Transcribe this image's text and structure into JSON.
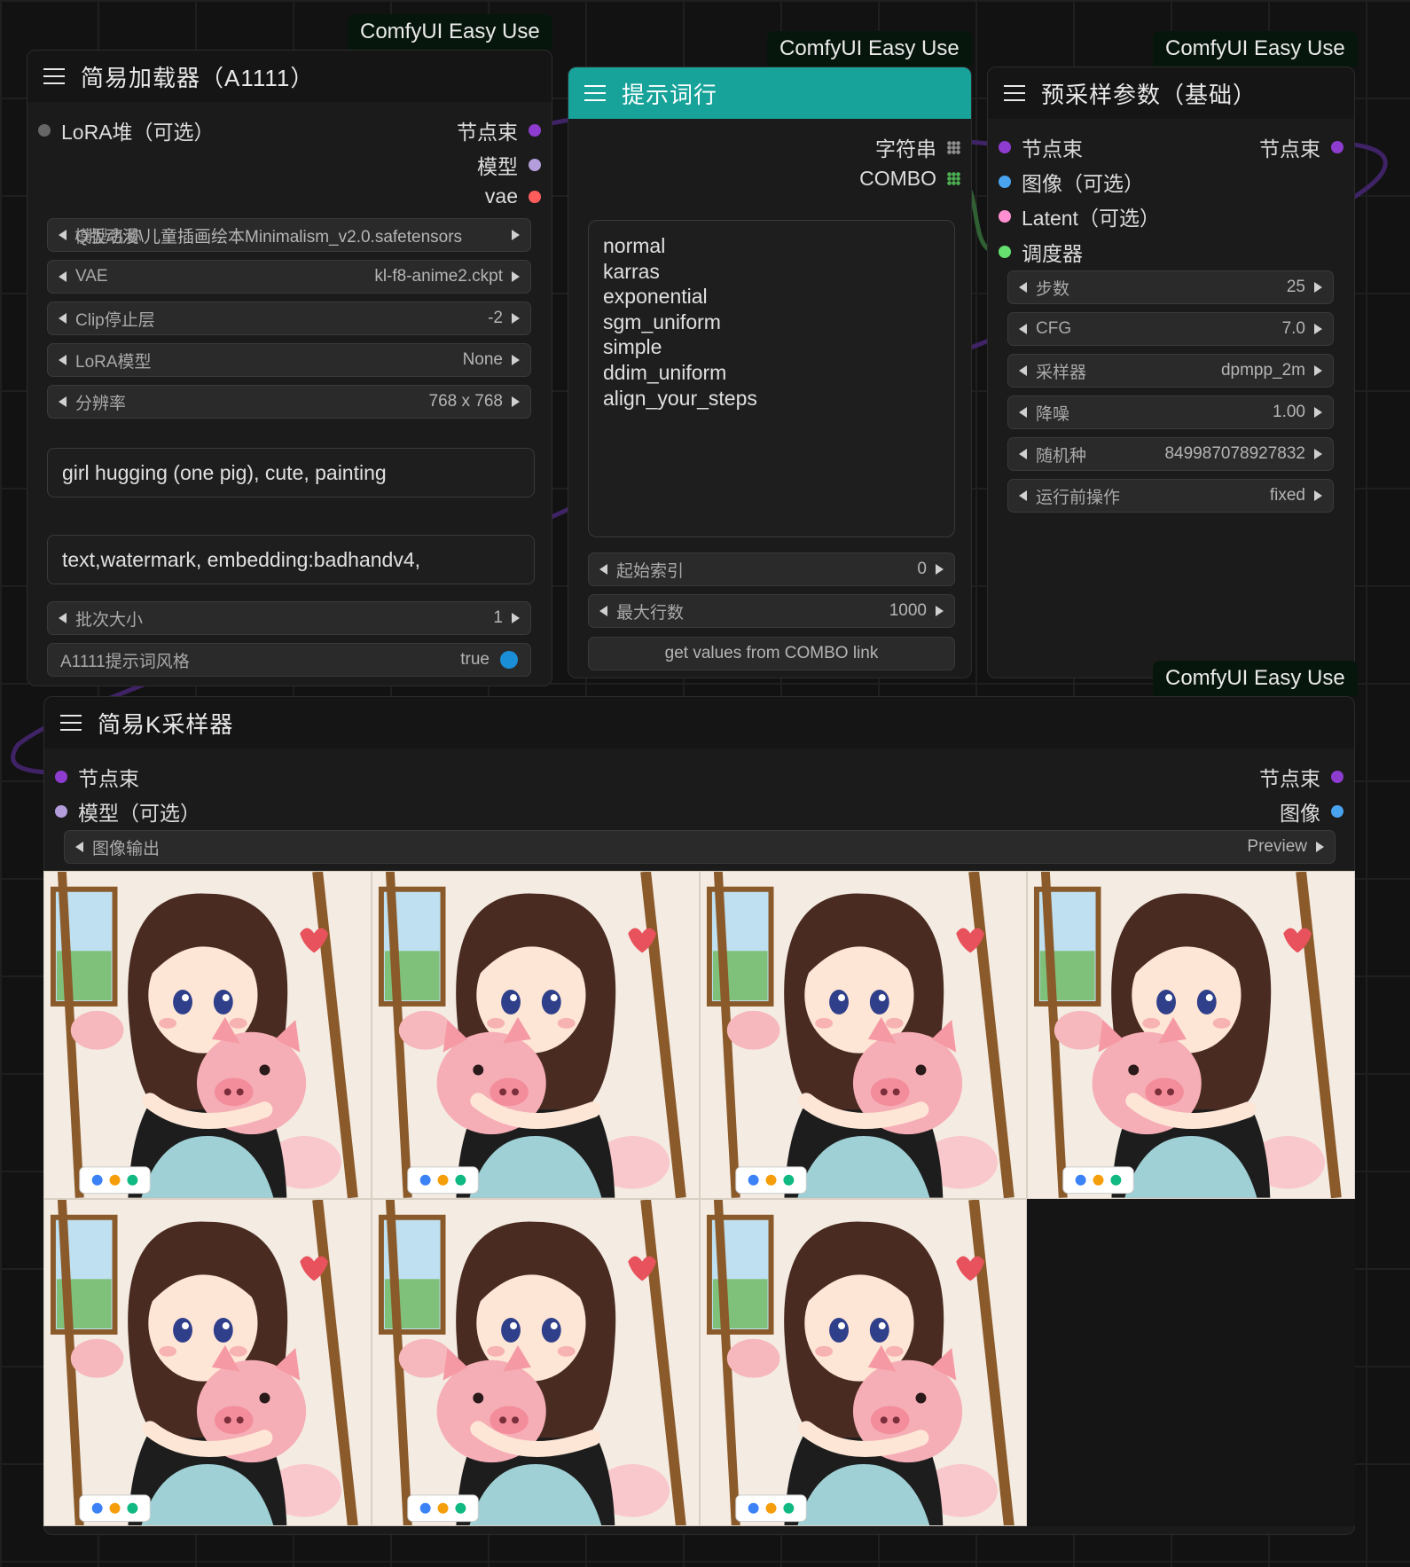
{
  "badge_text": "ComfyUI Easy Use",
  "loader": {
    "title": "简易加载器（A1111）",
    "input_lora_stack": "LoRA堆（可选）",
    "outputs": [
      "节点束",
      "模型",
      "vae"
    ],
    "widgets": [
      {
        "label": "模型名称",
        "value": "Q版动漫\\儿童插画绘本Minimalism_v2.0.safetensors"
      },
      {
        "label": "VAE",
        "value": "kl-f8-anime2.ckpt"
      },
      {
        "label": "Clip停止层",
        "value": "-2"
      },
      {
        "label": "LoRA模型",
        "value": "None"
      },
      {
        "label": "分辨率",
        "value": "768 x 768"
      }
    ],
    "positive": "girl hugging (one pig), cute, painting",
    "negative": "text,watermark, embedding:badhandv4,",
    "batch": {
      "label": "批次大小",
      "value": "1"
    },
    "a1111_style": {
      "label": "A1111提示词风格",
      "value": "true"
    }
  },
  "prompt_line": {
    "title": "提示词行",
    "outputs": [
      "字符串",
      "COMBO"
    ],
    "lines": [
      "normal",
      "karras",
      "exponential",
      "sgm_uniform",
      "simple",
      "ddim_uniform",
      "align_your_steps"
    ],
    "widgets": [
      {
        "label": "起始索引",
        "value": "0"
      },
      {
        "label": "最大行数",
        "value": "1000"
      }
    ],
    "button": "get values from COMBO link"
  },
  "presampler": {
    "title": "预采样参数（基础）",
    "inputs": [
      "节点束",
      "图像（可选）",
      "Latent（可选）",
      "调度器"
    ],
    "output": "节点束",
    "widgets": [
      {
        "label": "步数",
        "value": "25"
      },
      {
        "label": "CFG",
        "value": "7.0"
      },
      {
        "label": "采样器",
        "value": "dpmpp_2m"
      },
      {
        "label": "降噪",
        "value": "1.00"
      },
      {
        "label": "随机种",
        "value": "849987078927832"
      },
      {
        "label": "运行前操作",
        "value": "fixed"
      }
    ]
  },
  "ksampler": {
    "title": "简易K采样器",
    "inputs": [
      "节点束",
      "模型（可选）"
    ],
    "outputs": [
      "节点束",
      "图像"
    ],
    "widget": {
      "label": "图像输出",
      "value": "Preview"
    },
    "image_count": 7
  },
  "colors": {
    "pipe": "#8e3ccf",
    "model": "#b39ddb",
    "vae": "#ff5c5c",
    "image": "#4aa3ef",
    "latent": "#ff8fd0",
    "scheduler": "#66e06f",
    "combo": "#4caf50",
    "string": "#8f8f8f",
    "teal_header": "#17a39a",
    "wire": "#5a2a8a"
  }
}
